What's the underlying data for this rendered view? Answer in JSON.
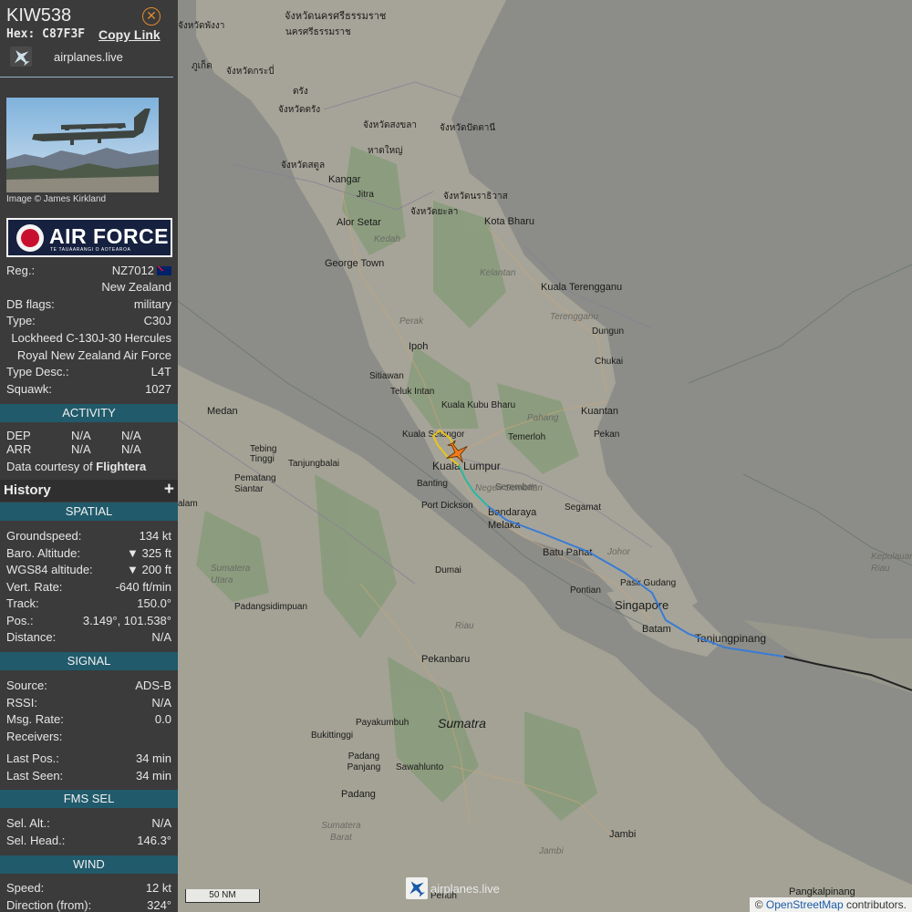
{
  "aircraft": {
    "callsign": "KIW538",
    "hex_label": "Hex:",
    "hex": "C87F3F",
    "copy_link": "Copy Link",
    "site_name": "airplanes.live",
    "close_icon": "close-icon"
  },
  "photo": {
    "credit": "Image © James Kirkland"
  },
  "operator_logo": {
    "text": "AIR FORCE",
    "subtitle": "TE TAUAARANGI O AOTEAROA"
  },
  "details": {
    "reg_label": "Reg.:",
    "reg": "NZ7012",
    "country": "New Zealand",
    "db_flags_label": "DB flags:",
    "db_flags": "military",
    "type_label": "Type:",
    "type": "C30J",
    "type_full": "Lockheed C-130J-30 Hercules",
    "operator": "Royal New Zealand Air Force",
    "type_desc_label": "Type Desc.:",
    "type_desc": "L4T",
    "squawk_label": "Squawk:",
    "squawk": "1027"
  },
  "activity": {
    "title": "ACTIVITY",
    "dep_label": "DEP",
    "dep_a": "N/A",
    "dep_b": "N/A",
    "arr_label": "ARR",
    "arr_a": "N/A",
    "arr_b": "N/A",
    "courtesy": "Data courtesy of",
    "courtesy_source": "Flightera"
  },
  "history": {
    "title": "History",
    "expand": "+"
  },
  "spatial": {
    "title": "SPATIAL",
    "groundspeed_label": "Groundspeed:",
    "groundspeed": "134 kt",
    "baro_label": "Baro. Altitude:",
    "baro": "▼ 325 ft",
    "wgs_label": "WGS84 altitude:",
    "wgs": "▼ 200 ft",
    "vert_label": "Vert. Rate:",
    "vert": "-640 ft/min",
    "track_label": "Track:",
    "track": "150.0°",
    "pos_label": "Pos.:",
    "pos": "3.149°, 101.538°",
    "distance_label": "Distance:",
    "distance": "N/A"
  },
  "signal": {
    "title": "SIGNAL",
    "source_label": "Source:",
    "source": "ADS-B",
    "rssi_label": "RSSI:",
    "rssi": "N/A",
    "msg_label": "Msg. Rate:",
    "msg": "0.0",
    "receivers_label": "Receivers:",
    "receivers": "",
    "lastpos_label": "Last Pos.:",
    "lastpos": "34 min",
    "lastseen_label": "Last Seen:",
    "lastseen": "34 min"
  },
  "fms": {
    "title": "FMS SEL",
    "alt_label": "Sel. Alt.:",
    "alt": "N/A",
    "head_label": "Sel. Head.:",
    "head": "146.3°"
  },
  "wind": {
    "title": "WIND",
    "speed_label": "Speed:",
    "speed": "12 kt",
    "dir_label": "Direction (from):",
    "dir": "324°"
  },
  "map": {
    "scale": "50 NM",
    "attribution_prefix": "©",
    "attribution_link": "OpenStreetMap",
    "attribution_suffix": "contributors.",
    "watermark": "airplanes.live",
    "place_labels": [
      "จังหวัดนครศรีธรรมราช",
      "นครศรีธรรมราช",
      "จังหวัดพังงา",
      "ภูเก็ต",
      "จังหวัดกระบี่",
      "ตรัง",
      "จังหวัดตรัง",
      "จังหวัดสงขลา",
      "จังหวัดปัตตานี",
      "หาดใหญ่",
      "จังหวัดสตูล",
      "Kangar",
      "Jitra",
      "จังหวัดนราธิวาส",
      "จังหวัดยะลา",
      "Alor Setar",
      "Kota Bharu",
      "George Town",
      "Kuala Terengganu",
      "Dungun",
      "Ipoh",
      "Chukai",
      "Sitiawan",
      "Teluk Intan",
      "Kuala Kubu Bharu",
      "Kuantan",
      "Medan",
      "Temerloh",
      "Pekan",
      "Kuala Selangor",
      "Tebing Tinggi",
      "Tanjungbalai",
      "Kuala Lumpur",
      "Pematang Siantar",
      "Banting",
      "Port Dickson",
      "Seremban",
      "Segamat",
      "Bandaraya Melaka",
      "Batu Pahat",
      "Dumai",
      "Pontian",
      "Pasir Gudang",
      "Singapore",
      "Batam",
      "Tanjungpinang",
      "Padangsidimpuan",
      "Pekanbaru",
      "Payakumbuh",
      "Sumatra",
      "Bukittinggi",
      "Padang Panjang",
      "Sawahlunto",
      "Padang",
      "Jambi",
      "Pangkalpinang",
      "Penuh",
      "alam"
    ],
    "region_labels": [
      "Kedah",
      "Kelantan",
      "Terengganu",
      "Perak",
      "Pahang",
      "Negeri Sembilan",
      "Johor",
      "Sumatera Utara",
      "Riau",
      "Sumatera Barat",
      "Jambi",
      "Kepulauan Riau"
    ],
    "aircraft_marker_color": "#f07a1a",
    "track_colors": [
      "#e8c51c",
      "#2bb7a3",
      "#3a7bd5",
      "#222222"
    ]
  }
}
